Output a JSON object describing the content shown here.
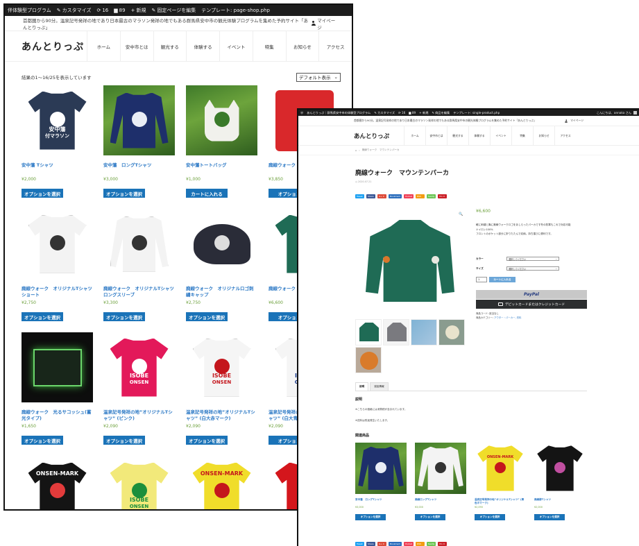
{
  "back": {
    "adminbar": {
      "site": "伴体験型プログラム",
      "customize": "カスタマイズ",
      "updates": "16",
      "comments": "89",
      "new": "新規",
      "edit": "固定ページを編集",
      "template": "テンプレート: page-shop.php"
    },
    "tagline": "首都圏から90分。温泉記号発祥の地であり日本最古のマラソン発祥の地でもある群馬県安中市の観光体験プログラムを集めた予約サイト「あんとりっぷ」",
    "mypage": "マイページ",
    "logo": "あんとりっぷ",
    "nav": [
      "ホーム",
      "安中市とは",
      "観光する",
      "体験する",
      "イベント",
      "特集",
      "お知らせ",
      "アクセス"
    ],
    "result_count": "結果の1〜16/25を表示しています",
    "sort": "デフォルト表示",
    "products": [
      {
        "name": "安中藩 Tシャツ",
        "price": "¥2,000",
        "button": "オプションを選択",
        "img_text": "安中藩",
        "img_sub": "付マラソン"
      },
      {
        "name": "安中藩　ロングTシャツ",
        "price": "¥3,000",
        "button": "オプションを選択"
      },
      {
        "name": "安中藩トートバッグ",
        "price": "¥1,000",
        "button": "カートに入れる"
      },
      {
        "name": "廃線ウォーク",
        "price": "¥3,850",
        "button": "オプション"
      },
      {
        "name": "廃線ウォーク　オリジナルTシャツ　ショート",
        "price": "¥2,750",
        "button": "オプションを選択"
      },
      {
        "name": "廃線ウォーク　オリジナルTシャツ　ロングスリーブ",
        "price": "¥3,300",
        "button": "オプションを選択"
      },
      {
        "name": "廃線ウォーク　オリジナルロゴ刺繍キャップ",
        "price": "¥2,750",
        "button": "オプションを選択"
      },
      {
        "name": "廃線ウォーク",
        "price": "¥6,600",
        "button": "オプション"
      },
      {
        "name": "廃線ウォーク　光るサコッシュ(蓄光タイプ)",
        "price": "¥1,650",
        "button": "オプションを選択"
      },
      {
        "name": "温泉記号発祥の地”オリジナルTシャツ” (ピンク)",
        "price": "¥2,090",
        "button": "オプションを選択",
        "img_text": "ISOBE",
        "img_sub": "ONSEN"
      },
      {
        "name": "温泉記号発祥の地”オリジナルTシャツ” (白大赤マーク)",
        "price": "¥2,090",
        "button": "オプションを選択",
        "img_text": "ISOBE",
        "img_sub": "ONSEN"
      },
      {
        "name": "温泉記号発祥の地”オリジナルTシャツ” (白大青マー",
        "price": "¥2,090",
        "button": "オプション",
        "img_text": "ISOBE",
        "img_sub": "ONSEN"
      },
      {
        "name": "",
        "price": "",
        "button": "",
        "img_text": "ONSEN-MARK"
      },
      {
        "name": "",
        "price": "",
        "button": "",
        "img_text": "ISOBE",
        "img_sub": "ONSEN"
      },
      {
        "name": "",
        "price": "",
        "button": "",
        "img_text": "ONSEN-MARK"
      },
      {
        "name": "",
        "price": "",
        "button": ""
      }
    ]
  },
  "front": {
    "adminbar": {
      "site": "あんとりっぷ｜群馬県安中市の体験型プログラム",
      "customize": "カスタマイズ",
      "updates": "16",
      "comments": "89",
      "new": "新規",
      "edit": "商品を編集",
      "template": "テンプレート: single-product.php",
      "greeting": "こんにちは、annaka さん"
    },
    "tagline": "首都圏から90分。温泉記号発祥の地であり日本最古のマラソン発祥の地でもある群馬県安中市の観光体験プログラムを集めた予約サイト「あんとりっぷ」",
    "mypage": "マイページ",
    "logo": "あんとりっぷ",
    "nav": [
      "ホーム",
      "安中市とは",
      "観光する",
      "体験する",
      "イベント",
      "特集",
      "お知らせ",
      "アクセス"
    ],
    "breadcrumb": "廃線ウォーク　マウンテンパーカ",
    "title": "廃線ウォーク　マウンテンパーカ",
    "date": "2020.07.21",
    "share": [
      {
        "label": "Tweet",
        "color": "#1da1f2"
      },
      {
        "label": "Share",
        "color": "#3b5998"
      },
      {
        "label": "G+ 0",
        "color": "#dd4b39"
      },
      {
        "label": "Bookmark",
        "color": "#2c6ebd"
      },
      {
        "label": "Pocket",
        "color": "#ef4056"
      },
      {
        "label": "RSS",
        "color": "#f39c12"
      },
      {
        "label": "feedly",
        "color": "#6cc655"
      },
      {
        "label": "Pin it",
        "color": "#cb2027"
      }
    ],
    "price": "¥6,600",
    "desc": [
      "軽に刺繍と胸に廃線ウォークロゴをあしらったパーカです冬の防寒もこれで対応可能",
      "ナイロン100%",
      "フロントのポケット部分に折りたたんで収納。持ち運びに便利です。"
    ],
    "options": [
      {
        "label": "カラー",
        "placeholder": "選択してください"
      },
      {
        "label": "サイズ",
        "placeholder": "選択してください"
      }
    ],
    "qty": "1",
    "add_to_cart": "カートに入れる",
    "paypal": "PayPal",
    "card": "デビットカードまたはクレジットカード",
    "meta_sku": "商品コード: 該当なし",
    "meta_cat_label": "商品カテゴリー: ",
    "meta_cat_link": "アウター・パーカー, 衣料",
    "tabs": [
      "説明",
      "追加情報"
    ],
    "desc_heading": "説明",
    "desc_lines": [
      "※こちらの価格には消費税が含まれています。",
      "※送料は別途発生いたします。"
    ],
    "related_heading": "関連商品",
    "related": [
      {
        "name": "安中藩　ロングTシャツ",
        "price": "¥3,000",
        "button": "オプションを選択"
      },
      {
        "name": "廃線ロングTシャツ",
        "price": "¥3,000",
        "button": "オプションを選択"
      },
      {
        "name": "温泉記号発祥の地”オリジナルTシャツ” (黄色ホマーク)",
        "price": "¥2,090",
        "button": "オプションを選択",
        "img_text": "ONSEN-MARK"
      },
      {
        "name": "廃線跡Tシャツ",
        "price": "¥2,000",
        "button": "オプションを選択"
      }
    ]
  }
}
